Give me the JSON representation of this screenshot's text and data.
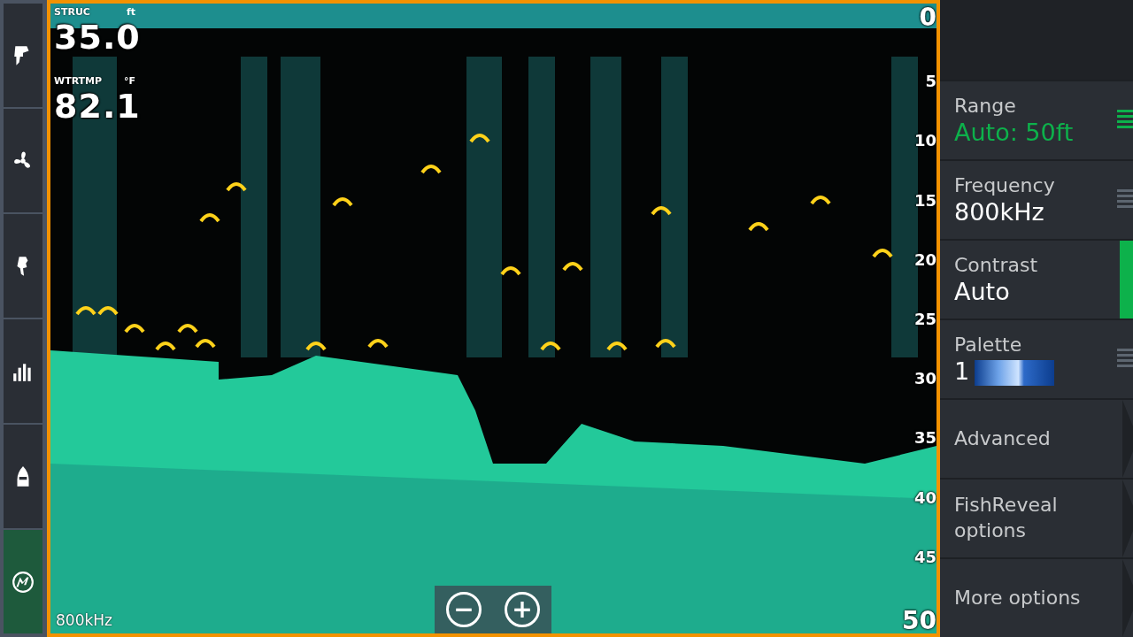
{
  "sidebar": {
    "items": [
      {
        "selected": false
      },
      {
        "selected": false
      },
      {
        "selected": false
      },
      {
        "selected": false
      },
      {
        "selected": false
      },
      {
        "selected": true
      }
    ]
  },
  "sonar": {
    "readouts": [
      {
        "label": "STRUC",
        "unit": "ft",
        "value": "35.0"
      },
      {
        "label": "WTRTMP",
        "unit": "°F",
        "value": "82.1"
      }
    ],
    "depth_scale": [
      "0",
      "5",
      "10",
      "15",
      "20",
      "25",
      "30",
      "35",
      "40",
      "45",
      "50"
    ],
    "frequency": "800kHz",
    "zoom_buttons": [
      "−",
      "+"
    ]
  },
  "menu": {
    "items": [
      {
        "kind": "list",
        "label": "Range",
        "value": "Auto: 50ft",
        "selected": true
      },
      {
        "kind": "list",
        "label": "Frequency",
        "value": "800kHz",
        "selected": false
      },
      {
        "kind": "slider",
        "label": "Contrast",
        "value": "Auto"
      },
      {
        "kind": "palette",
        "label": "Palette",
        "value": "1",
        "selected": false
      },
      {
        "kind": "submenu",
        "label": "Advanced"
      },
      {
        "kind": "submenu",
        "label": "FishReveal options"
      },
      {
        "kind": "submenu",
        "label": "More options"
      }
    ]
  }
}
